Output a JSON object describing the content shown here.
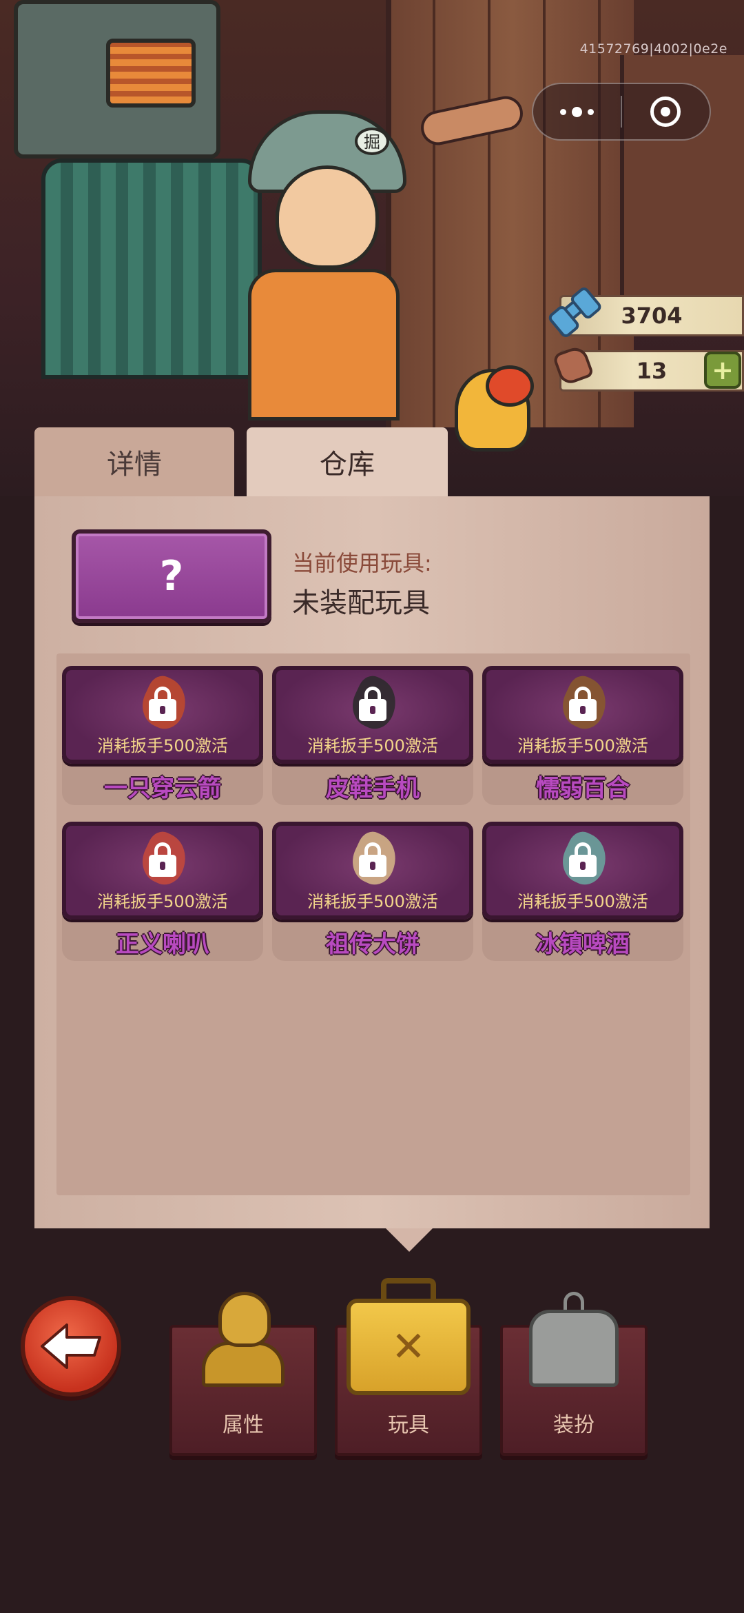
{
  "session_id": "41572769|4002|0e2e",
  "capsule": {
    "more_icon": "more-dots-icon",
    "target_icon": "target-icon"
  },
  "currencies": [
    {
      "icon": "wrench-icon",
      "value": "3704"
    },
    {
      "icon": "stone-icon",
      "value": "13"
    }
  ],
  "tabs": [
    {
      "label": "详情",
      "active": false
    },
    {
      "label": "仓库",
      "active": true
    }
  ],
  "current_toy": {
    "slot_symbol": "?",
    "label": "当前使用玩具:",
    "value": "未装配玩具"
  },
  "toys": [
    {
      "name": "一只穿云箭",
      "cost": "消耗扳手500激活",
      "locked": true,
      "color": "#c24a2a"
    },
    {
      "name": "皮鞋手机",
      "cost": "消耗扳手500激活",
      "locked": true,
      "color": "#2a2a2a"
    },
    {
      "name": "懦弱百合",
      "cost": "消耗扳手500激活",
      "locked": true,
      "color": "#8a5a2a"
    },
    {
      "name": "正义喇叭",
      "cost": "消耗扳手500激活",
      "locked": true,
      "color": "#c84a3a"
    },
    {
      "name": "祖传大饼",
      "cost": "消耗扳手500激活",
      "locked": true,
      "color": "#d8b888"
    },
    {
      "name": "冰镇啤酒",
      "cost": "消耗扳手500激活",
      "locked": true,
      "color": "#6aa8a0"
    }
  ],
  "bottom_nav": {
    "back_icon": "back-arrow-icon",
    "items": [
      {
        "label": "属性",
        "icon": "character-bust-icon"
      },
      {
        "label": "玩具",
        "icon": "toolbox-icon",
        "active": true
      },
      {
        "label": "装扮",
        "icon": "shirt-hanger-icon"
      }
    ]
  },
  "colors": {
    "panel": "#dcc2b4",
    "toy_card": "#5a2452",
    "toy_name": "#b84ac0",
    "cost_text": "#f2d58a",
    "back_button": "#c8321e"
  }
}
